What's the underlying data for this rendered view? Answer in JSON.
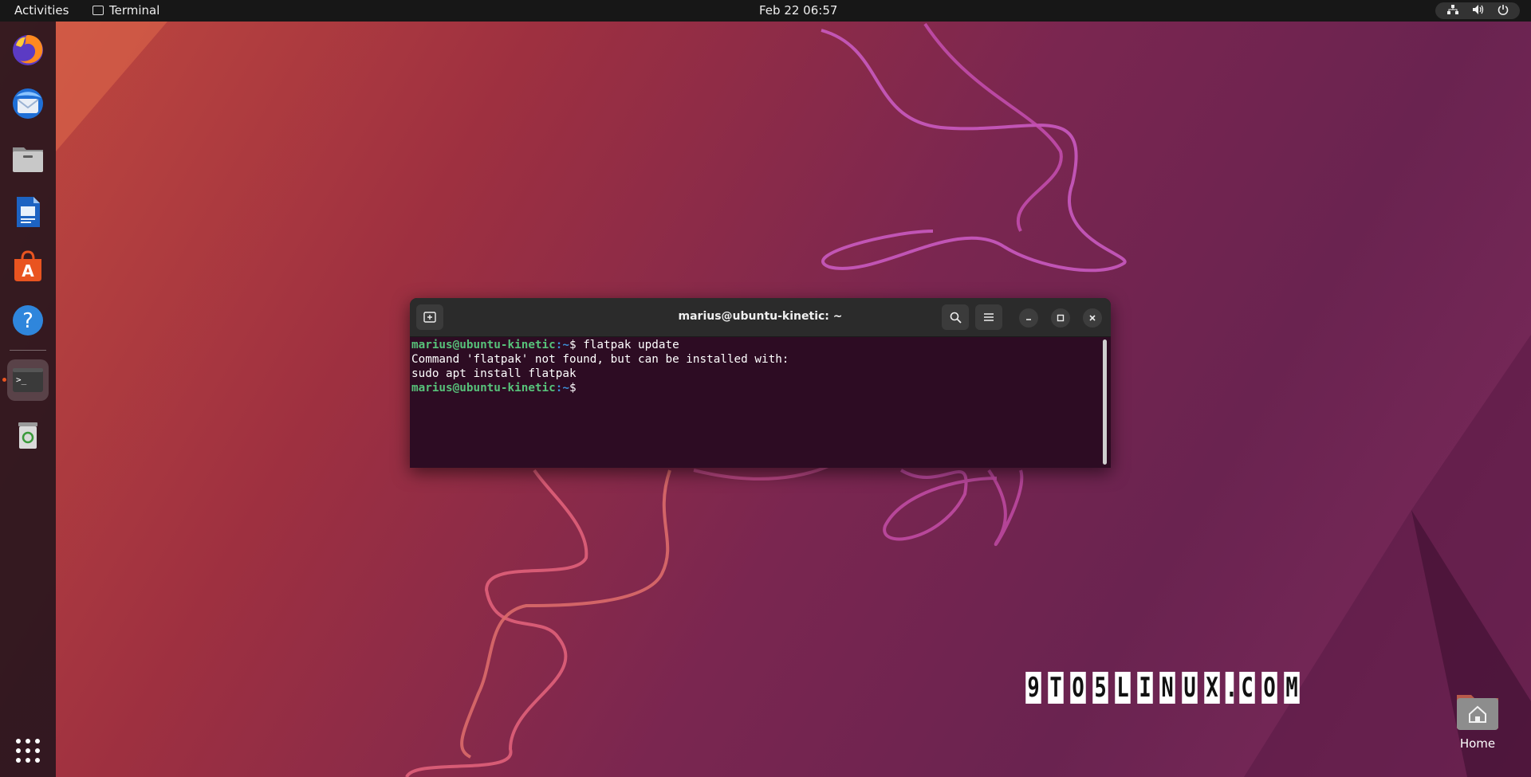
{
  "topbar": {
    "activities": "Activities",
    "app_name": "Terminal",
    "clock": "Feb 22  06:57"
  },
  "dock": {
    "items": [
      {
        "name": "firefox-icon"
      },
      {
        "name": "thunderbird-icon"
      },
      {
        "name": "files-icon"
      },
      {
        "name": "writer-icon"
      },
      {
        "name": "app-center-icon"
      },
      {
        "name": "help-icon"
      },
      {
        "name": "terminal-icon"
      },
      {
        "name": "trash-icon"
      }
    ]
  },
  "terminal": {
    "title": "marius@ubuntu-kinetic: ~",
    "lines": [
      {
        "user": "marius@ubuntu-kinetic",
        "dir": ":~",
        "text": "$ flatpak update"
      },
      {
        "text": "Command 'flatpak' not found, but can be installed with:"
      },
      {
        "text": "sudo apt install flatpak"
      },
      {
        "user": "marius@ubuntu-kinetic",
        "dir": ":~",
        "text": "$"
      }
    ]
  },
  "watermark": "9TO5LINUX.COM",
  "desktop": {
    "home_label": "Home"
  },
  "colors": {
    "ubuntu_orange": "#e95420",
    "terminal_bg": "#2d0c23",
    "prompt_user": "#57c27a",
    "prompt_dir": "#3d8fd6"
  }
}
